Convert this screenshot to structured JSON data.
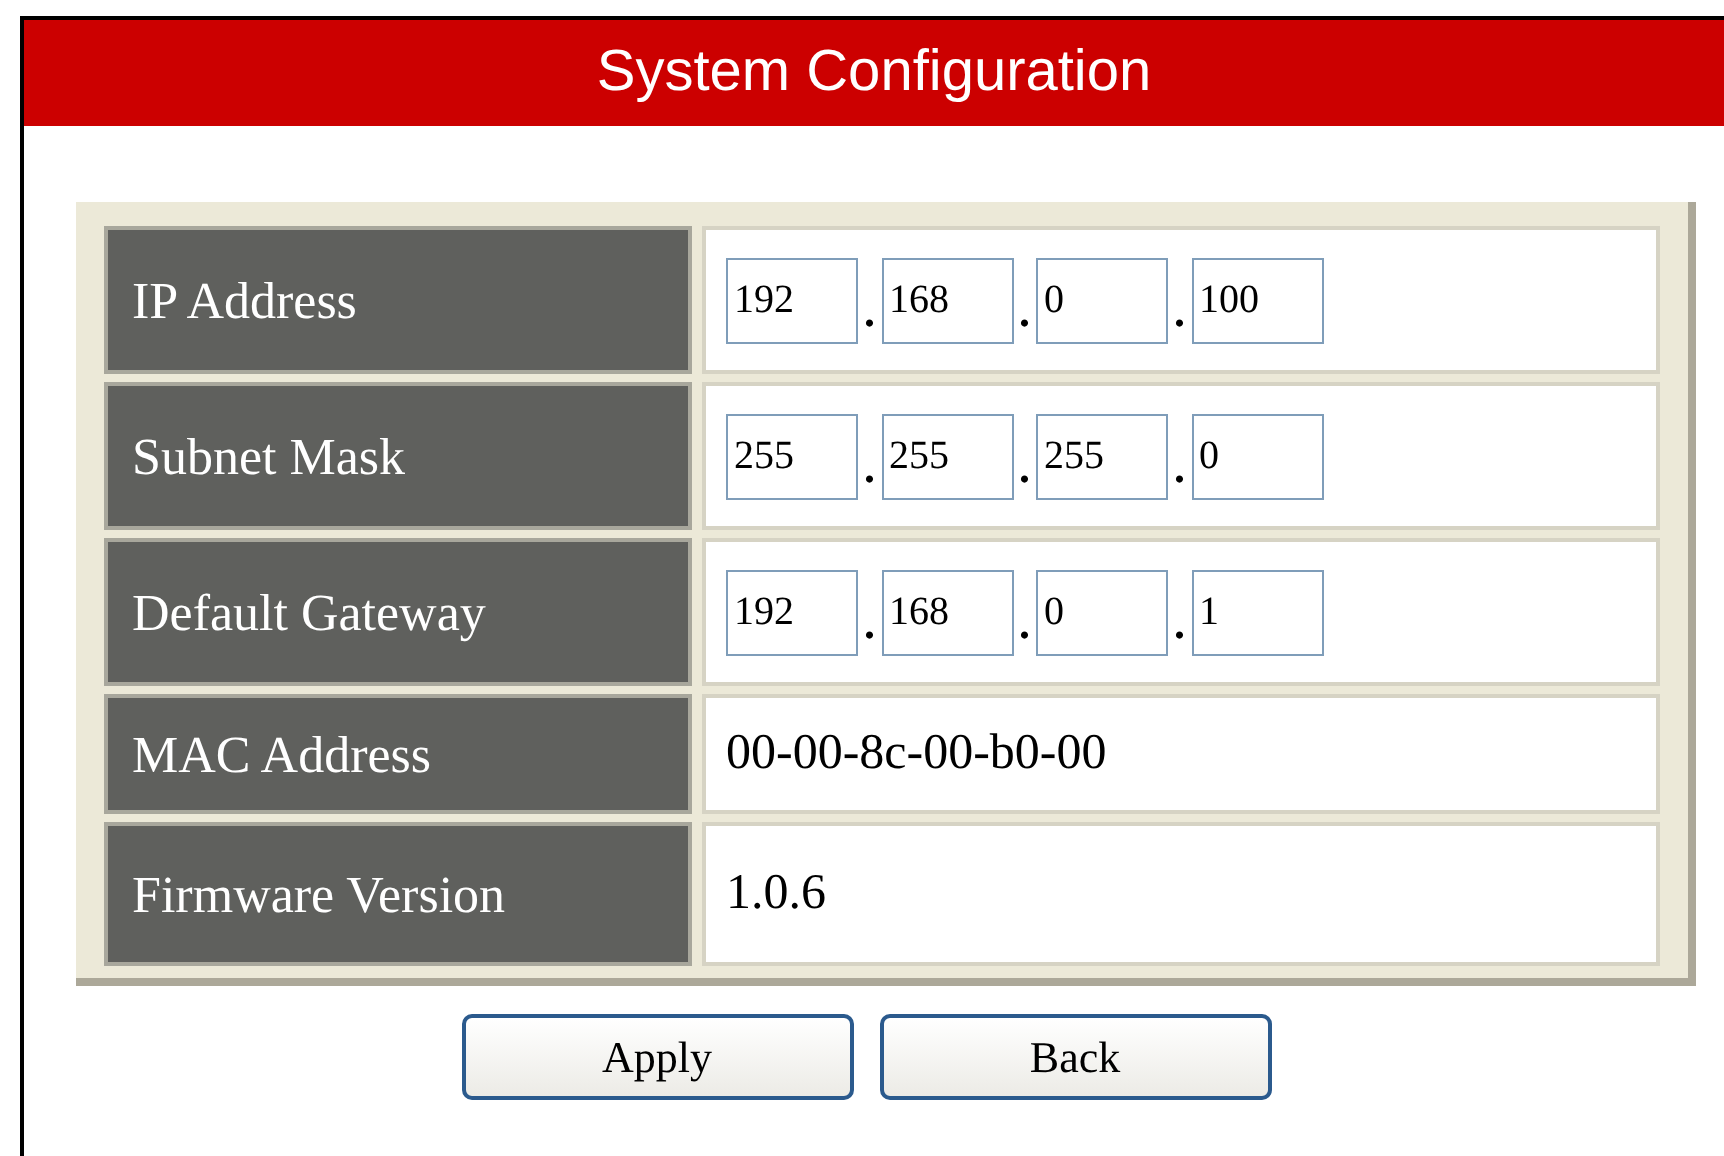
{
  "title": "System Configuration",
  "rows": [
    {
      "label": "IP Address",
      "kind": "ip",
      "octets": [
        "192",
        "168",
        "0",
        "100"
      ]
    },
    {
      "label": "Subnet Mask",
      "kind": "ip",
      "octets": [
        "255",
        "255",
        "255",
        "0"
      ]
    },
    {
      "label": "Default Gateway",
      "kind": "ip",
      "octets": [
        "192",
        "168",
        "0",
        "1"
      ]
    },
    {
      "label": "MAC Address",
      "kind": "text",
      "value": "00-00-8c-00-b0-00"
    },
    {
      "label": "Firmware Version",
      "kind": "text",
      "value": "1.0.6"
    }
  ],
  "separator": ".",
  "buttons": [
    "Apply",
    "Back"
  ]
}
